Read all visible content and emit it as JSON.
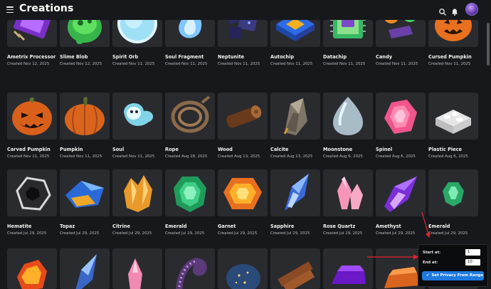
{
  "header": {
    "title": "Creations",
    "menu_icon": "hamburger-menu-icon",
    "search_icon": "search-icon",
    "notification_icon": "bell-icon",
    "avatar": "user-avatar"
  },
  "items": [
    {
      "name": "Ametrix Processor",
      "date": "Created Nov 12, 2025",
      "icon": "ametrix-processor"
    },
    {
      "name": "Slime Blob",
      "date": "Created Nov 12, 2025",
      "icon": "slime-blob"
    },
    {
      "name": "Spirit Orb",
      "date": "Created Nov 11, 2025",
      "icon": "spirit-orb"
    },
    {
      "name": "Soul Fragment",
      "date": "Created Nov 11, 2025",
      "icon": "soul-fragment"
    },
    {
      "name": "Neptunite",
      "date": "Created Nov 11, 2025",
      "icon": "neptunite"
    },
    {
      "name": "Autochip",
      "date": "Created Nov 11, 2025",
      "icon": "autochip"
    },
    {
      "name": "Datachip",
      "date": "Created Nov 11, 2025",
      "icon": "datachip"
    },
    {
      "name": "Candy",
      "date": "Created Nov 11, 2025",
      "icon": "candy"
    },
    {
      "name": "Cursed Pumpkin",
      "date": "Created Nov 11, 2025",
      "icon": "cursed-pumpkin"
    },
    {
      "name": "Carved Pumpkin",
      "date": "Created Nov 11, 2025",
      "icon": "carved-pumpkin"
    },
    {
      "name": "Pumpkin",
      "date": "Created Nov 11, 2025",
      "icon": "pumpkin"
    },
    {
      "name": "Soul",
      "date": "Created Nov 11, 2025",
      "icon": "soul"
    },
    {
      "name": "Rope",
      "date": "Created Aug 28, 2025",
      "icon": "rope"
    },
    {
      "name": "Wood",
      "date": "Created Aug 13, 2025",
      "icon": "wood"
    },
    {
      "name": "Calcite",
      "date": "Created Aug 13, 2025",
      "icon": "calcite"
    },
    {
      "name": "Moonstone",
      "date": "Created Aug 6, 2025",
      "icon": "moonstone"
    },
    {
      "name": "Spinel",
      "date": "Created Aug 6, 2025",
      "icon": "spinel"
    },
    {
      "name": "Plastic Piece",
      "date": "Created Aug 6, 2025",
      "icon": "plastic-piece"
    },
    {
      "name": "Hematite",
      "date": "Created Jul 29, 2025",
      "icon": "hematite"
    },
    {
      "name": "Topaz",
      "date": "Created Jul 29, 2025",
      "icon": "topaz"
    },
    {
      "name": "Citrine",
      "date": "Created Jul 29, 2025",
      "icon": "citrine"
    },
    {
      "name": "Emerald",
      "date": "Created Jul 29, 2025",
      "icon": "emerald"
    },
    {
      "name": "Garnet",
      "date": "Created Jul 29, 2025",
      "icon": "garnet"
    },
    {
      "name": "Sapphire",
      "date": "Created Jul 29, 2025",
      "icon": "sapphire"
    },
    {
      "name": "Rose Quartz",
      "date": "Created Jul 29, 2025",
      "icon": "rose-quartz"
    },
    {
      "name": "Amethyst",
      "date": "Created Jul 29, 2025",
      "icon": "amethyst"
    },
    {
      "name": "Emerald",
      "date": "Created Jul 29, 2025",
      "icon": "emerald-small"
    },
    {
      "name": "",
      "date": "",
      "icon": "fire-gem"
    },
    {
      "name": "",
      "date": "",
      "icon": "blue-crystal"
    },
    {
      "name": "",
      "date": "",
      "icon": "pink-crystal"
    },
    {
      "name": "",
      "date": "",
      "icon": "tentacle"
    },
    {
      "name": "",
      "date": "",
      "icon": "starry-stone"
    },
    {
      "name": "",
      "date": "",
      "icon": "wood-planks"
    },
    {
      "name": "",
      "date": "",
      "icon": "purple-ingot"
    },
    {
      "name": "",
      "date": "",
      "icon": "copper-ingot"
    },
    {
      "name": "",
      "date": "",
      "icon": "green-item"
    }
  ],
  "popup": {
    "start_label": "Start at:",
    "start_value": "1",
    "end_label": "End at:",
    "end_value": "10",
    "apply_label": "Set Privacy From Range"
  },
  "colors": {
    "background": "#17181b",
    "card": "#2a2b2f",
    "accent": "#1f7ae0",
    "annotation_arrow": "#e0252b"
  }
}
